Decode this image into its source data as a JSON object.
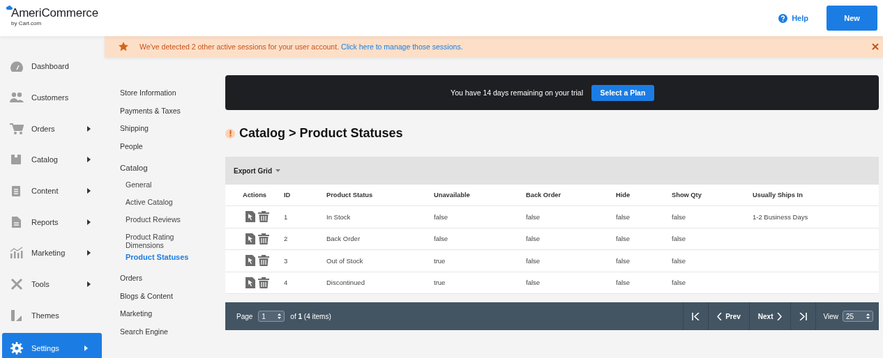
{
  "brand": {
    "name": "AmeriCommerce",
    "byline": "by Cart.com"
  },
  "header": {
    "help": "Help",
    "new_button": "New"
  },
  "notice": {
    "text": "We've detected 2 other active sessions for your user account.",
    "link": "Click here to manage those sessions."
  },
  "nav": [
    {
      "label": "Dashboard",
      "has_submenu": false,
      "selected": false
    },
    {
      "label": "Customers",
      "has_submenu": false,
      "selected": false
    },
    {
      "label": "Orders",
      "has_submenu": true,
      "selected": false
    },
    {
      "label": "Catalog",
      "has_submenu": true,
      "selected": false
    },
    {
      "label": "Content",
      "has_submenu": true,
      "selected": false
    },
    {
      "label": "Reports",
      "has_submenu": true,
      "selected": false
    },
    {
      "label": "Marketing",
      "has_submenu": true,
      "selected": false
    },
    {
      "label": "Tools",
      "has_submenu": true,
      "selected": false
    },
    {
      "label": "Themes",
      "has_submenu": false,
      "selected": false
    },
    {
      "label": "Settings",
      "has_submenu": true,
      "selected": true
    }
  ],
  "subnav": [
    {
      "label": "Store Information",
      "selected": false
    },
    {
      "label": "Payments & Taxes",
      "selected": false
    },
    {
      "label": "Shipping",
      "selected": false
    },
    {
      "label": "People",
      "selected": false
    },
    {
      "label": "Catalog",
      "selected": false,
      "children": [
        {
          "label": "General",
          "selected": false
        },
        {
          "label": "Active Catalog",
          "selected": false
        },
        {
          "label": "Product Reviews",
          "selected": false
        },
        {
          "label": "Product Rating Dimensions",
          "selected": false
        },
        {
          "label": "Product Statuses",
          "selected": true
        }
      ]
    },
    {
      "label": "Orders",
      "selected": false
    },
    {
      "label": "Blogs & Content",
      "selected": false
    },
    {
      "label": "Marketing",
      "selected": false
    },
    {
      "label": "Search Engine",
      "selected": false
    }
  ],
  "trial": {
    "text": "You have 14 days remaining on your trial",
    "button": "Select a Plan"
  },
  "title": "Catalog > Product Statuses",
  "grid": {
    "export": "Export Grid",
    "columns": [
      "Actions",
      "ID",
      "Product Status",
      "Unavailable",
      "Back Order",
      "Hide",
      "Show Qty",
      "Usually Ships In"
    ],
    "rows": [
      [
        "",
        "1",
        "In Stock",
        "false",
        "false",
        "false",
        "false",
        "1-2 Business Days"
      ],
      [
        "",
        "2",
        "Back Order",
        "false",
        "false",
        "false",
        "false",
        ""
      ],
      [
        "",
        "3",
        "Out of Stock",
        "true",
        "false",
        "false",
        "false",
        ""
      ],
      [
        "",
        "4",
        "Discontinued",
        "true",
        "false",
        "false",
        "false",
        ""
      ]
    ]
  },
  "pager": {
    "page_label": "Page",
    "page": "1",
    "of_prefix": "of",
    "of_total": "1",
    "items": "(4 items)",
    "prev": "Prev",
    "next": "Next",
    "view_label": "View",
    "view": "25"
  }
}
